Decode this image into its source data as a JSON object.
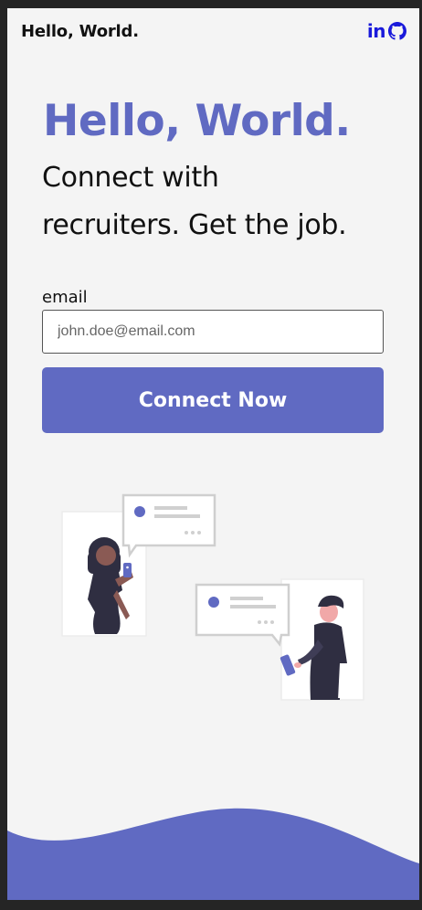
{
  "header": {
    "brand": "Hello, World.",
    "linkedin_icon": "linkedin-icon",
    "github_icon": "github-icon",
    "icon_color": "#1a1adb"
  },
  "hero": {
    "title": "Hello, World.",
    "subtitle_line1": "Connect with",
    "subtitle_line2": "recruiters. Get the job."
  },
  "form": {
    "email_label": "email",
    "email_placeholder": "john.doe@email.com",
    "submit_label": "Connect Now"
  },
  "theme": {
    "accent": "#606ac2",
    "background": "#f4f4f4"
  }
}
